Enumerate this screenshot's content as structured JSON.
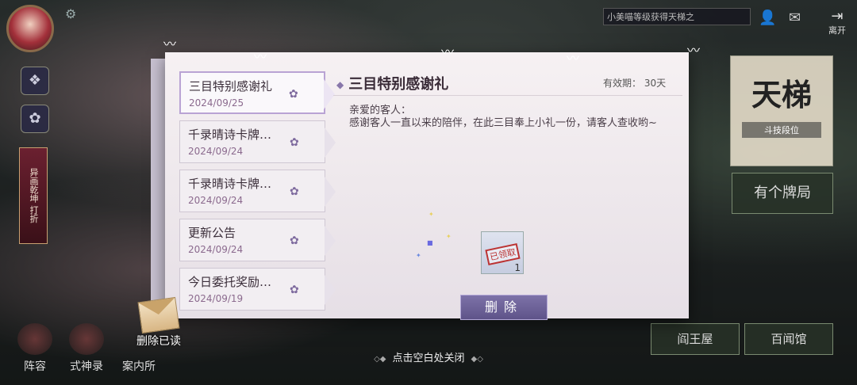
{
  "top_bar": {
    "news_text": "小美喵等级获得天梯之",
    "leave_label": "离开"
  },
  "side": {
    "scroll_text": "异画乾坤 打折"
  },
  "bottom_nav": [
    {
      "label": "阵容"
    },
    {
      "label": "式神录"
    },
    {
      "label": "案内所"
    }
  ],
  "right_panel": {
    "tianti_title": "天梯",
    "tianti_sub": "斗技段位",
    "card_game_label": "有个牌局",
    "button1_label": "阎王屋",
    "button2_label": "百闻馆"
  },
  "mail": {
    "items": [
      {
        "title": "三目特别感谢礼",
        "date": "2024/09/25",
        "active": true
      },
      {
        "title": "千录晴诗卡牌…",
        "date": "2024/09/24"
      },
      {
        "title": "千录晴诗卡牌…",
        "date": "2024/09/24"
      },
      {
        "title": "更新公告",
        "date": "2024/09/24"
      },
      {
        "title": "今日委托奖励…",
        "date": "2024/09/19"
      }
    ],
    "detail": {
      "title": "三目特别感谢礼",
      "validity": "有效期： 30天",
      "greeting": "亲爱的客人：",
      "body": "感谢客人一直以来的陪伴，在此三目奉上小礼一份，请客人查收哟~",
      "reward_stamp": "已领取",
      "reward_count": "1",
      "delete_label": "删除"
    },
    "delete_read_label": "删除已读"
  },
  "close_hint": "点击空白处关闭"
}
